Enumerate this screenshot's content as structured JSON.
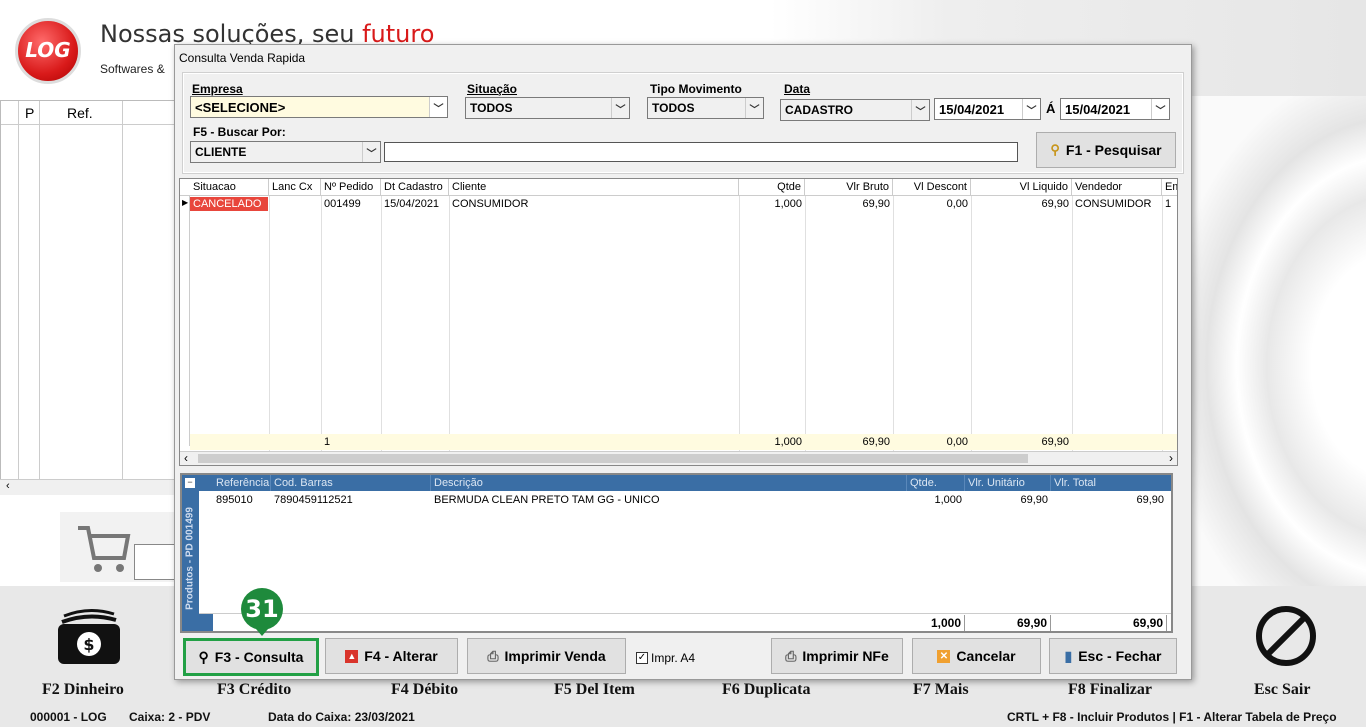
{
  "app": {
    "logo_text": "LOG",
    "slogan_main": "Nossas soluções, seu ",
    "slogan_accent": "futuro",
    "slogan_sub": "Softwares &",
    "left_grid_headers": [
      "P",
      "Ref."
    ]
  },
  "footer_keys": [
    "F2 Dinheiro",
    "F3 Crédito",
    "F4 Débito",
    "F5 Del Item",
    "F6 Duplicata",
    "F7 Mais",
    "F8 Finalizar",
    "Esc Sair"
  ],
  "status": {
    "terminal": "000001 - LOG",
    "caixa": "Caixa: 2 - PDV",
    "data_caixa": "Data do Caixa: 23/03/2021",
    "hint": "CRTL + F8 - Incluir Produtos | F1 - Alterar Tabela de Preço"
  },
  "dialog": {
    "title": "Consulta Venda Rapida",
    "empresa_label": "Empresa",
    "empresa_value": "<SELECIONE>",
    "situacao_label": "Situação",
    "situacao_value": "TODOS",
    "tipo_label": "Tipo Movimento",
    "tipo_value": "TODOS",
    "data_label": "Data",
    "data_value": "CADASTRO",
    "date_from": "15/04/2021",
    "date_sep": "Á",
    "date_to": "15/04/2021",
    "buscar_label": "F5 - Buscar Por:",
    "buscar_value": "CLIENTE",
    "search_text": "",
    "pesquisar": "F1 - Pesquisar"
  },
  "sales_grid": {
    "headers": [
      "Situacao",
      "Lanc Cx",
      "Nº Pedido",
      "Dt Cadastro",
      "Cliente",
      "Qtde",
      "Vlr Bruto",
      "Vl Descont",
      "Vl Liquido",
      "Vendedor",
      "Em"
    ],
    "row": [
      "CANCELADO",
      "",
      "001499",
      "15/04/2021",
      "CONSUMIDOR",
      "1,000",
      "69,90",
      "0,00",
      "69,90",
      "CONSUMIDOR",
      "1"
    ],
    "totals": [
      "",
      "",
      "1",
      "",
      "",
      "1,000",
      "69,90",
      "0,00",
      "69,90",
      "",
      ""
    ]
  },
  "items_grid": {
    "side_label": "Produtos - PD 001499",
    "headers": [
      "Referência",
      "Cod. Barras",
      "Descrição",
      "Qtde.",
      "Vlr. Unitário",
      "Vlr. Total"
    ],
    "row": [
      "895010",
      "7890459112521",
      "BERMUDA CLEAN PRETO TAM  GG - UNICO",
      "1,000",
      "69,90",
      "69,90"
    ],
    "totals": [
      "",
      "",
      "",
      "1,000",
      "69,90",
      "69,90"
    ]
  },
  "buttons": {
    "consulta": "F3 - Consulta",
    "alterar": "F4 - Alterar",
    "imprimir_venda": "Imprimir Venda",
    "impr_a4": "Impr. A4",
    "imprimir_nfe": "Imprimir NFe",
    "cancelar": "Cancelar",
    "fechar": "Esc - Fechar"
  },
  "annotation": {
    "badge": "31",
    "color": "#1e8a3c"
  },
  "colors": {
    "cancelado": "#e8463c",
    "header_blue": "#3a6ea5",
    "totals_bg": "#fffbe0"
  }
}
